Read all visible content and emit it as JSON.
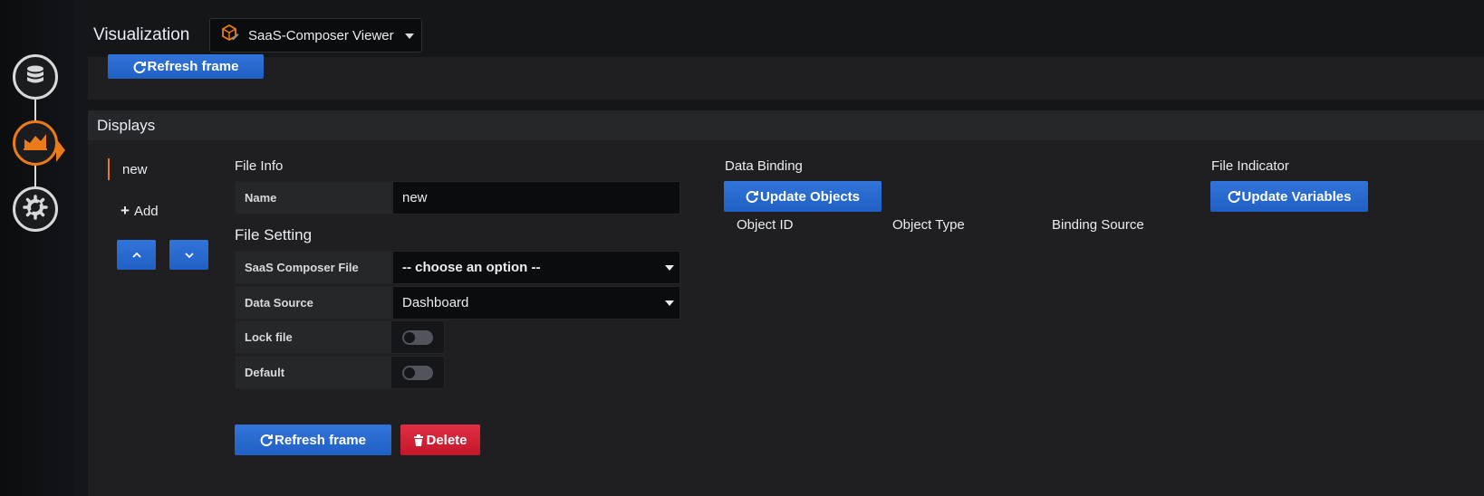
{
  "header": {
    "title": "Visualization",
    "viz_select_value": "SaaS-Composer Viewer"
  },
  "upper_panel": {
    "refresh_label": "Refresh frame"
  },
  "displays": {
    "title": "Displays",
    "items": [
      {
        "label": "new",
        "active": true
      }
    ],
    "add_label": "Add"
  },
  "file_info": {
    "title": "File Info",
    "name_label": "Name",
    "name_value": "new"
  },
  "file_setting": {
    "title": "File Setting",
    "composer_file_label": "SaaS Composer File",
    "composer_file_value": "-- choose an option --",
    "data_source_label": "Data Source",
    "data_source_value": "Dashboard",
    "lock_label": "Lock file",
    "lock_on": false,
    "default_label": "Default",
    "default_on": false
  },
  "actions": {
    "refresh_label": "Refresh frame",
    "delete_label": "Delete"
  },
  "data_binding": {
    "title": "Data Binding",
    "update_label": "Update Objects",
    "columns": [
      "Object ID",
      "Object Type",
      "Binding Source"
    ]
  },
  "file_indicator": {
    "title": "File Indicator",
    "update_label": "Update Variables"
  },
  "colors": {
    "accent": "#eb7b18",
    "primary": "#3274d9",
    "danger": "#e02f44",
    "background": "#141619"
  },
  "icons": {
    "rail": [
      "database-icon",
      "chart-area-icon",
      "settings-icon"
    ],
    "refresh": "refresh-icon",
    "delete": "trash-icon",
    "add": "plus-icon"
  }
}
